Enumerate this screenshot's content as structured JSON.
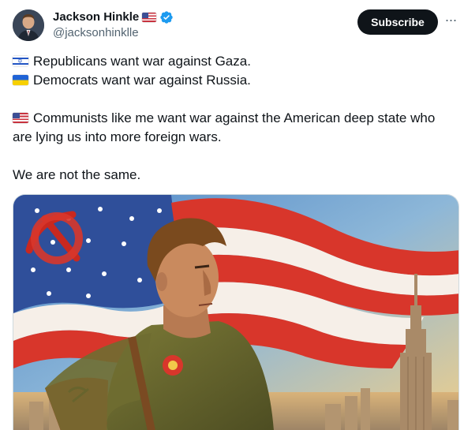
{
  "author": {
    "name": "Jackson Hinkle",
    "handle": "@jacksonhinklle",
    "flag_icon": "us-flag-icon",
    "verified_icon": "verified-badge-icon",
    "verified_color": "#1d9bf0"
  },
  "header": {
    "subscribe_label": "Subscribe",
    "more_icon": "more-options-icon",
    "more_glyph": "···"
  },
  "tweet": {
    "lines": [
      {
        "flag": "israel-flag-icon",
        "text": "Republicans want war against Gaza."
      },
      {
        "flag": "ukraine-flag-icon",
        "text": "Democrats want war against Russia."
      },
      {
        "flag": "",
        "text": ""
      },
      {
        "flag": "us-flag-icon",
        "text": "Communists like me want war against the American deep state who are lying us into more foreign wars."
      },
      {
        "flag": "",
        "text": ""
      },
      {
        "flag": "",
        "text": "We are not the same."
      }
    ]
  },
  "media": {
    "description_icon": "painting-man-flag-skyline-image",
    "colors": {
      "sky_blue": "#5f8fc0",
      "flag_red": "#d8362b",
      "flag_blue": "#2f4f9a",
      "jacket": "#6b6a2e",
      "skin": "#c98a5e",
      "hair": "#7a4a1e",
      "skyline": "#c5a576"
    }
  }
}
